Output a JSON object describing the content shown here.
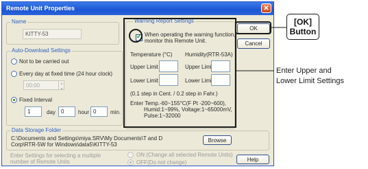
{
  "dialog": {
    "title": "Remote Unit Properties",
    "close_glyph": "✕"
  },
  "name_group": {
    "legend": "Name",
    "value": "KITTY-53"
  },
  "auto_download": {
    "legend": "Auto-Download Settings",
    "options": {
      "not_carried_out": "Not to be carried out",
      "every_day": "Every day at fixed time (24 hour clock)",
      "fixed_interval": "Fixed Interval"
    },
    "selected": "fixed_interval",
    "time_value": "00:00",
    "interval": {
      "day_value": "1",
      "day_unit": "day",
      "hour_value": "0",
      "hour_unit": "hour",
      "min_value": "0",
      "min_unit": "min."
    }
  },
  "warning": {
    "legend": "Warning Report Settings",
    "monitor_checked": true,
    "monitor_label_line1": "When operating the warning function,",
    "monitor_label_line2": "monitor this Remote Unit.",
    "temperature_header": "Temperature (°C)",
    "humidity_header": "Humidity(RTR-53A)",
    "upper_limit": "Upper Limit",
    "lower_limit": "Lower Limit",
    "step_note": "(0.1 step in Cent. / 0.2 step in Fahr.)",
    "range_line1": "Enter Temp.-60~155°C(F Pt -200~600),",
    "range_line2": "Humid:1~99%, Voltage:1~65000mV,",
    "range_line3": "Pulse:1~32000"
  },
  "buttons": {
    "ok": "OK",
    "cancel": "Cancel",
    "browse": "Browse",
    "help": "Help"
  },
  "storage": {
    "legend": "Data Storage Folder",
    "path_line1": "C:\\Documents and Settings\\miya.SRV\\My Documents\\T and D",
    "path_line2": "Corp\\RTR-5W for Windows\\data5\\KITTY-53"
  },
  "multi": {
    "note_line1": "Enter Settings for selecting a multiple",
    "note_line2": "number of Remote Units",
    "on_label": "ON (Change all selected Remote Units)",
    "off_label": "OFF(Do not change)"
  },
  "annotations": {
    "ok_callout_line1": "[OK]",
    "ok_callout_line2": "Button",
    "limits_line1": "Enter Upper and",
    "limits_line2": "Lower Limit Settings"
  },
  "colors": {
    "title_bar": "#1c55d4",
    "legend_text": "#2f5fc0",
    "dialog_bg": "#ece9d8",
    "checkbox_check": "#21a121"
  }
}
